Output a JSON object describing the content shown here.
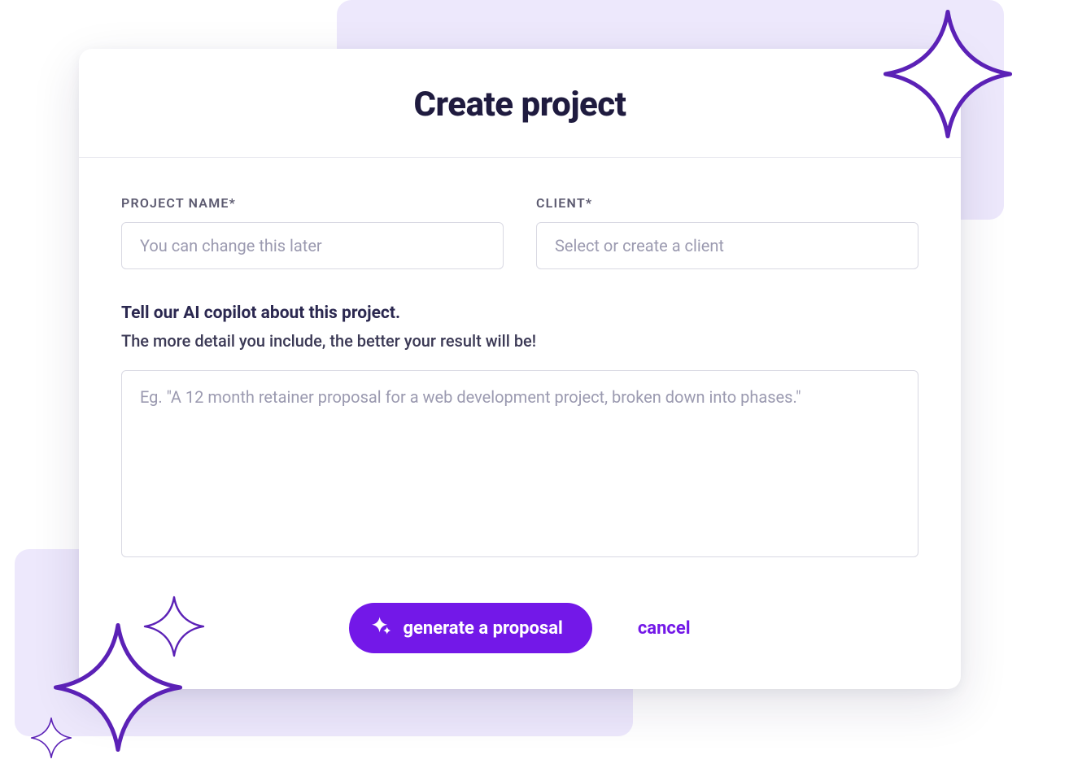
{
  "modal": {
    "title": "Create project",
    "project_name": {
      "label": "PROJECT NAME*",
      "placeholder": "You can change this later"
    },
    "client": {
      "label": "CLIENT*",
      "placeholder": "Select or create a client"
    },
    "ai": {
      "heading": "Tell our AI copilot about this project.",
      "subheading": "The more detail you include, the better your result will be!",
      "placeholder": "Eg. \"A 12 month retainer proposal for a web development project, broken down into phases.\""
    },
    "actions": {
      "generate": "generate a proposal",
      "cancel": "cancel"
    }
  }
}
